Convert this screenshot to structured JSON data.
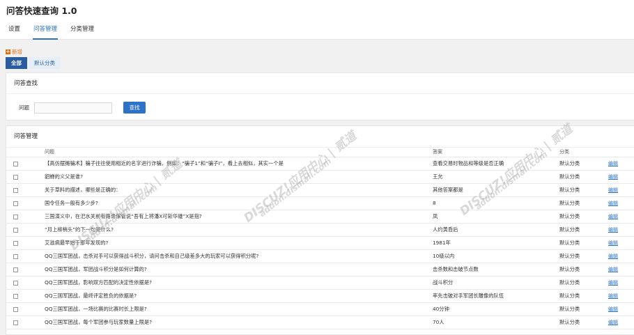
{
  "app": {
    "title": "问答快速查询 1.0"
  },
  "tabs": [
    {
      "label": "设置"
    },
    {
      "label": "问答管理"
    },
    {
      "label": "分类管理"
    }
  ],
  "toolbar": {
    "add_label": "新增"
  },
  "filters": [
    {
      "label": "全部"
    },
    {
      "label": "默认分类"
    }
  ],
  "search": {
    "title": "问答查找",
    "field_label": "问题",
    "value": "",
    "button_label": "查找"
  },
  "manage": {
    "title": "问答管理",
    "columns": {
      "question": "问题",
      "answer": "答案",
      "category": "分类"
    },
    "edit_label": "编辑",
    "rows": [
      {
        "q": "【高仿摆摊骗术】骗子往往使用相近的名字进行诈骗，例如：“骗子1”和“骗子I”，看上去相似，其实一个是",
        "a": "查看交易时物品和等级是否正确",
        "c": "默认分类"
      },
      {
        "q": "貂蝉的义父是谁?",
        "a": "王允",
        "c": "默认分类"
      },
      {
        "q": "关于草料的描述，哪些是正确的：",
        "a": "其他答案都是",
        "c": "默认分类"
      },
      {
        "q": "国令任务一般有多少步?",
        "a": "8",
        "c": "默认分类"
      },
      {
        "q": "三国演义中，在汜水关前有路谗保管说“吾有上将潘X可斩华雄”X是指?",
        "a": "凤",
        "c": "默认分类"
      },
      {
        "q": "“月上柳梢头”的下一句是什么?",
        "a": "人约黄昏后",
        "c": "默认分类"
      },
      {
        "q": "艾滋病最早始于那年发现的?",
        "a": "1981年",
        "c": "默认分类"
      },
      {
        "q": "QQ三国军团战，击杀对手可以获得战斗积分，请问击杀和自己级差多大的玩家可以获得积分呢?",
        "a": "10级以内",
        "c": "默认分类"
      },
      {
        "q": "QQ三国军团战，军团战斗积分是如何计算的?",
        "a": "击杀数和击破节点数",
        "c": "默认分类"
      },
      {
        "q": "QQ三国军团战，影响双方匹配的决定性依据是?",
        "a": "战斗积分",
        "c": "默认分类"
      },
      {
        "q": "QQ三国军团战，最终评定胜负的依据是?",
        "a": "率先击破对手军团长雕像的队伍",
        "c": "默认分类"
      },
      {
        "q": "QQ三国军团战，一场比赛的比赛时长上限是?",
        "a": "40分钟",
        "c": "默认分类"
      },
      {
        "q": "QQ三国军团战，每个军团参与玩家数量上限是?",
        "a": "70人",
        "c": "默认分类"
      }
    ]
  },
  "watermark": {
    "brand": "DISCUZ!应用中心 | 贰道",
    "url": "addon.dismall.com"
  }
}
